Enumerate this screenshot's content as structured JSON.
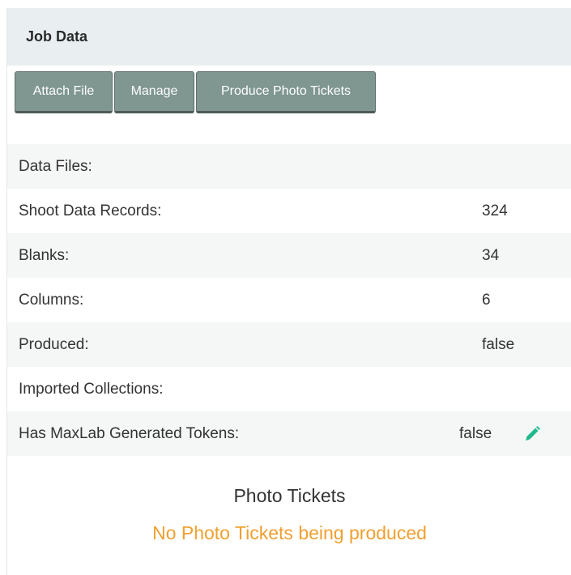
{
  "panel": {
    "title": "Job Data"
  },
  "toolbar": {
    "attach_label": "Attach File",
    "manage_label": "Manage",
    "produce_label": "Produce Photo Tickets"
  },
  "rows": [
    {
      "label": "Data Files:",
      "value": ""
    },
    {
      "label": "Shoot Data Records:",
      "value": "324"
    },
    {
      "label": "Blanks:",
      "value": "34"
    },
    {
      "label": "Columns:",
      "value": "6"
    },
    {
      "label": "Produced:",
      "value": "false"
    },
    {
      "label": "Imported Collections:",
      "value": ""
    },
    {
      "label": "Has MaxLab Generated Tokens:",
      "value": "false"
    }
  ],
  "photo_tickets": {
    "title": "Photo Tickets",
    "status": "No Photo Tickets being produced"
  },
  "icons": {
    "edit": "pencil-icon"
  },
  "colors": {
    "button_bg": "#7f9691",
    "header_bg": "#e9eff1",
    "row_shade": "#f5f6f6",
    "status_orange": "#f0a030",
    "edit_icon": "#1fba8c"
  }
}
